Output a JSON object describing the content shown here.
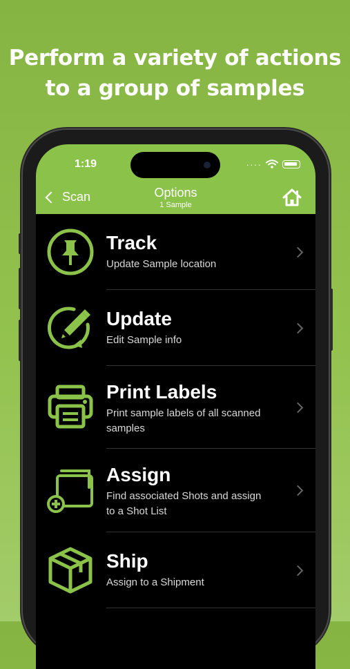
{
  "headline": {
    "line1": "Perform a variety of actions",
    "line2": "to a group of samples"
  },
  "status_bar": {
    "time": "1:19",
    "signal": "····"
  },
  "nav": {
    "back_label": "Scan",
    "title": "Options",
    "subtitle": "1 Sample",
    "home_icon": "home-icon"
  },
  "options": [
    {
      "title": "Track",
      "subtitle": "Update Sample location",
      "icon": "pushpin-icon"
    },
    {
      "title": "Update",
      "subtitle": "Edit Sample info",
      "icon": "edit-pencil-icon"
    },
    {
      "title": "Print Labels",
      "subtitle": "Print sample labels of all scanned samples",
      "icon": "printer-icon"
    },
    {
      "title": "Assign",
      "subtitle": "Find associated Shots and assign to a Shot List",
      "icon": "add-to-list-icon"
    },
    {
      "title": "Ship",
      "subtitle": "Assign to a Shipment",
      "icon": "package-box-icon"
    }
  ],
  "colors": {
    "accent": "#8bc24a",
    "background": "#000000"
  }
}
